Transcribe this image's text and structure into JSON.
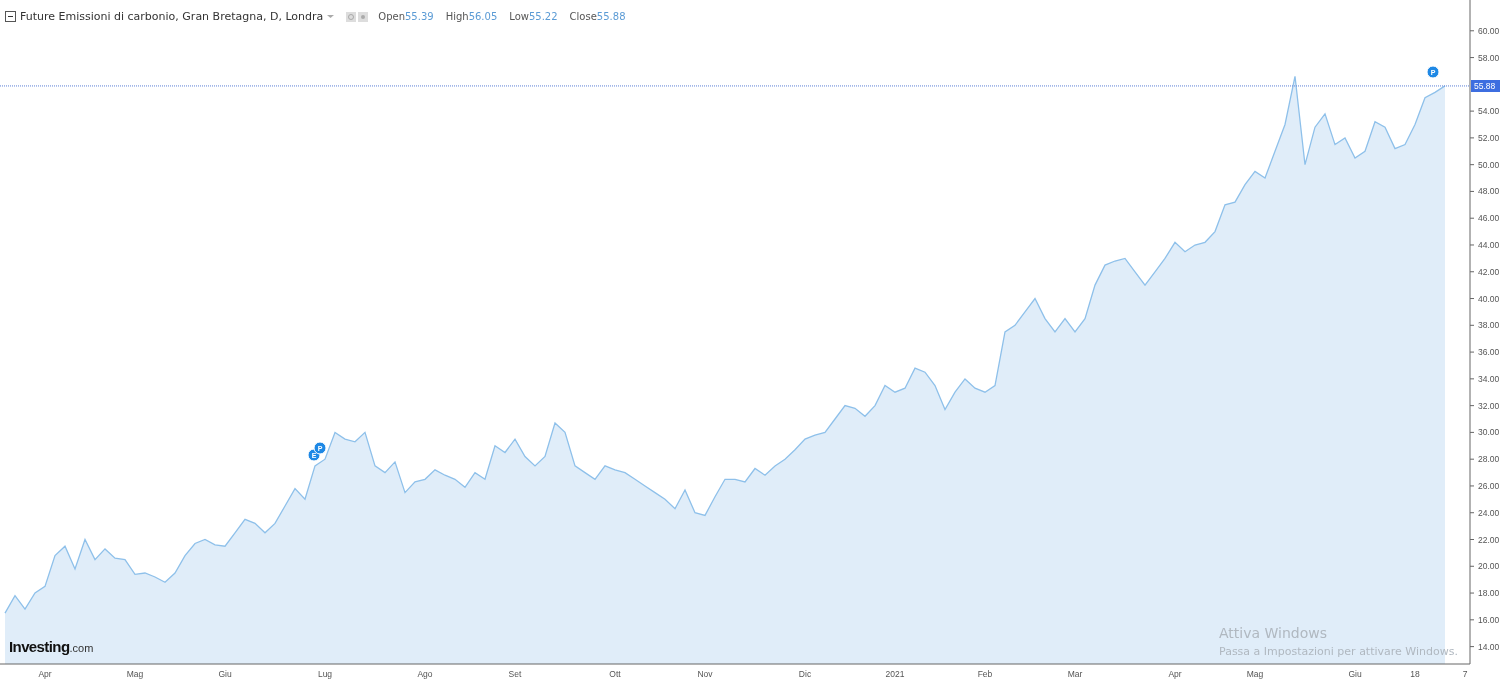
{
  "legend": {
    "title": "Future Emissioni di carbonio, Gran Bretagna, D, Londra",
    "ohlc": [
      {
        "label": "Open",
        "value": "55.39"
      },
      {
        "label": "High",
        "value": "56.05"
      },
      {
        "label": "Low",
        "value": "55.22"
      },
      {
        "label": "Close",
        "value": "55.88"
      }
    ]
  },
  "chart": {
    "price_label": "55.88",
    "markers": [
      {
        "label": "E"
      },
      {
        "label": "P"
      },
      {
        "label": "P"
      }
    ],
    "chart_data": {
      "type": "area",
      "ylim": [
        12.7,
        62.3
      ],
      "yticks": [
        {
          "value": 14,
          "label": "14.00"
        },
        {
          "value": 16,
          "label": "16.00"
        },
        {
          "value": 18,
          "label": "18.00"
        },
        {
          "value": 20,
          "label": "20.00"
        },
        {
          "value": 22,
          "label": "22.00"
        },
        {
          "value": 24,
          "label": "24.00"
        },
        {
          "value": 26,
          "label": "26.00"
        },
        {
          "value": 28,
          "label": "28.00"
        },
        {
          "value": 30,
          "label": "30.00"
        },
        {
          "value": 32,
          "label": "32.00"
        },
        {
          "value": 34,
          "label": "34.00"
        },
        {
          "value": 36,
          "label": "36.00"
        },
        {
          "value": 38,
          "label": "38.00"
        },
        {
          "value": 40,
          "label": "40.00"
        },
        {
          "value": 42,
          "label": "42.00"
        },
        {
          "value": 44,
          "label": "44.00"
        },
        {
          "value": 46,
          "label": "46.00"
        },
        {
          "value": 48,
          "label": "48.00"
        },
        {
          "value": 50,
          "label": "50.00"
        },
        {
          "value": 52,
          "label": "52.00"
        },
        {
          "value": 54,
          "label": "54.00"
        },
        {
          "value": 58,
          "label": "58.00"
        },
        {
          "value": 60,
          "label": "60.00"
        }
      ],
      "categories": [
        null,
        null,
        null,
        null,
        "Apr",
        null,
        null,
        null,
        null,
        null,
        null,
        null,
        null,
        "Mag",
        null,
        null,
        null,
        null,
        null,
        null,
        null,
        null,
        "Giu",
        null,
        null,
        null,
        null,
        null,
        null,
        null,
        null,
        null,
        "Lug",
        null,
        null,
        null,
        null,
        null,
        null,
        null,
        null,
        null,
        "Ago",
        null,
        null,
        null,
        null,
        null,
        null,
        null,
        null,
        "Set",
        null,
        null,
        null,
        null,
        null,
        null,
        null,
        null,
        null,
        "Ott",
        null,
        null,
        null,
        null,
        null,
        null,
        null,
        null,
        "Nov",
        null,
        null,
        null,
        null,
        null,
        null,
        null,
        null,
        null,
        "Dic",
        null,
        null,
        null,
        null,
        null,
        null,
        null,
        null,
        "2021",
        null,
        null,
        null,
        null,
        null,
        null,
        null,
        null,
        "Feb",
        null,
        null,
        null,
        null,
        null,
        null,
        null,
        null,
        "Mar",
        null,
        null,
        null,
        null,
        null,
        null,
        null,
        null,
        null,
        "Apr",
        null,
        null,
        null,
        null,
        null,
        null,
        null,
        "Mag",
        null,
        null,
        null,
        null,
        null,
        null,
        null,
        null,
        null,
        "Giu",
        null,
        null,
        null,
        null,
        null,
        "18",
        null,
        null,
        null,
        null,
        "7"
      ],
      "series": [
        {
          "color": "#8ec0ea",
          "values": [
            16.5,
            17.8,
            16.8,
            18,
            18.5,
            20.8,
            21.5,
            19.8,
            22,
            20.5,
            21.3,
            20.6,
            20.5,
            19.4,
            19.5,
            19.2,
            18.8,
            19.5,
            20.8,
            21.7,
            22,
            21.6,
            21.5,
            22.5,
            23.5,
            23.2,
            22.5,
            23.2,
            24.5,
            25.8,
            25,
            27.5,
            28,
            30,
            29.5,
            29.3,
            30,
            27.5,
            27,
            27.8,
            25.5,
            26.3,
            26.5,
            27.2,
            26.8,
            26.5,
            25.9,
            27,
            26.5,
            29,
            28.5,
            29.5,
            28.2,
            27.5,
            28.2,
            30.7,
            30,
            27.5,
            27,
            26.5,
            27.5,
            27.2,
            27,
            26.5,
            26,
            25.5,
            25,
            24.3,
            25.7,
            24,
            23.8,
            25.2,
            26.5,
            26.5,
            26.3,
            27.3,
            26.8,
            27.5,
            28,
            28.7,
            29.5,
            29.8,
            30,
            31,
            32,
            31.8,
            31.2,
            32,
            33.5,
            33,
            33.3,
            34.8,
            34.5,
            33.5,
            31.7,
            33,
            34,
            33.3,
            33,
            33.5,
            37.5,
            38,
            39,
            40,
            38.5,
            37.5,
            38.5,
            37.5,
            38.5,
            41,
            42.5,
            42.8,
            43,
            42,
            41,
            42,
            43,
            44.2,
            43.5,
            44,
            44.2,
            45,
            47,
            47.2,
            48.5,
            49.5,
            49,
            51,
            53,
            56.6,
            50,
            52.8,
            53.8,
            51.5,
            52,
            50.5,
            51,
            53.2,
            52.8,
            51.2,
            51.5,
            53,
            55,
            55.4,
            55.88,
            null,
            null
          ]
        }
      ]
    }
  },
  "logo": {
    "name": "Investing",
    "suffix": ".com"
  },
  "os_notice": {
    "title": "Attiva Windows",
    "text": "Passa a Impostazioni per attivare Windows."
  }
}
